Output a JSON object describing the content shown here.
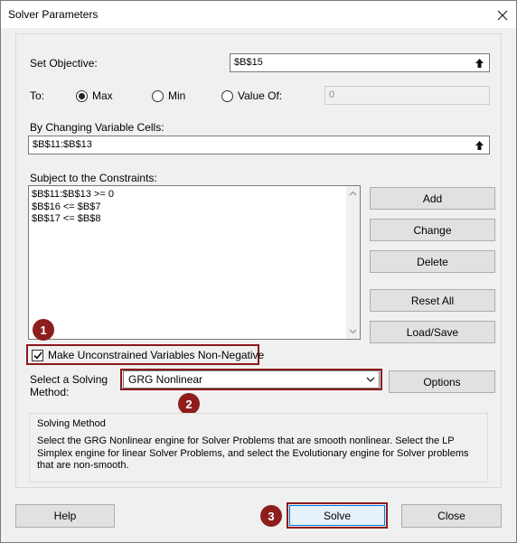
{
  "window": {
    "title": "Solver Parameters"
  },
  "objective": {
    "label": "Set Objective:",
    "value": "$B$15"
  },
  "to": {
    "label": "To:",
    "options": [
      {
        "label": "Max",
        "selected": true
      },
      {
        "label": "Min",
        "selected": false
      },
      {
        "label": "Value Of:",
        "selected": false
      }
    ],
    "value_of": "0"
  },
  "changing": {
    "label": "By Changing Variable Cells:",
    "value": "$B$11:$B$13"
  },
  "constraints": {
    "label": "Subject to the Constraints:",
    "items": [
      "$B$11:$B$13 >= 0",
      "$B$16 <= $B$7",
      "$B$17 <= $B$8"
    ]
  },
  "side_buttons": {
    "add": "Add",
    "change": "Change",
    "delete": "Delete",
    "reset_all": "Reset All",
    "load_save": "Load/Save",
    "options": "Options"
  },
  "nonneg": {
    "label": "Make Unconstrained Variables Non-Negative",
    "checked": true
  },
  "method": {
    "label_line1": "Select a Solving",
    "label_line2": "Method:",
    "selected": "GRG Nonlinear"
  },
  "solving_method": {
    "heading": "Solving Method",
    "description": "Select the GRG Nonlinear engine for Solver Problems that are smooth nonlinear. Select the LP Simplex engine for linear Solver Problems, and select the Evolutionary engine for Solver problems that are non-smooth."
  },
  "footer": {
    "help": "Help",
    "solve": "Solve",
    "close": "Close"
  },
  "badges": [
    "1",
    "2",
    "3"
  ],
  "colors": {
    "highlight": "#8b1a1a",
    "badge": "#8e1e1e"
  }
}
